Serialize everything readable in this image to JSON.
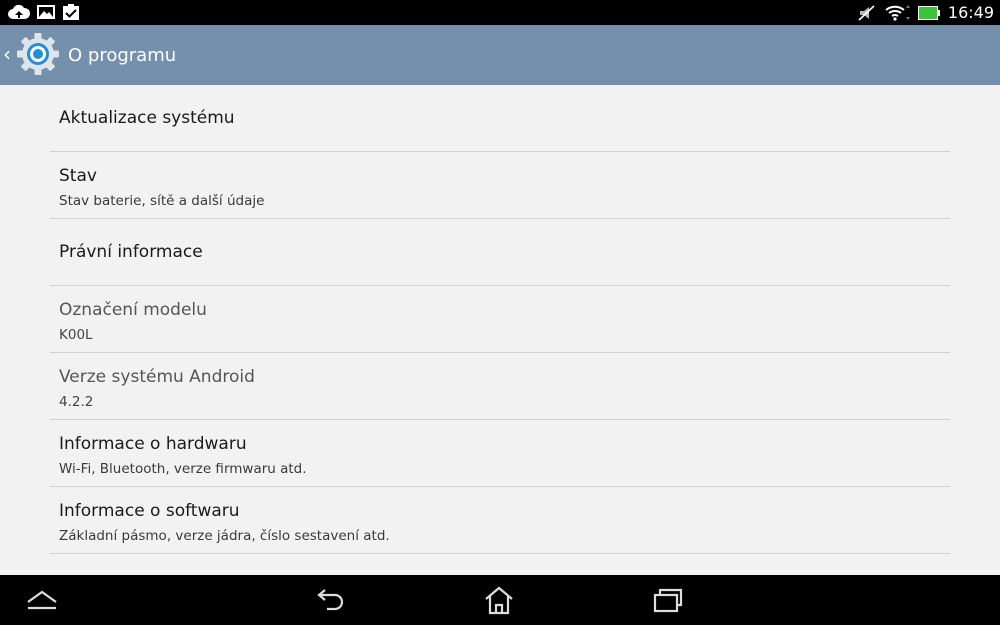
{
  "status_bar": {
    "time": "16:49",
    "left_icons": [
      "cloud-upload-icon",
      "image-icon",
      "clipboard-check-icon"
    ],
    "right_icons": [
      "mute-icon",
      "wifi-icon",
      "battery-icon"
    ]
  },
  "action_bar": {
    "title": "O programu",
    "back_glyph": "‹",
    "accent_color": "#7490ac"
  },
  "items": [
    {
      "title": "Aktualizace systému",
      "subtitle": "",
      "enabled": true
    },
    {
      "title": "Stav",
      "subtitle": "Stav baterie, sítě a další údaje",
      "enabled": true
    },
    {
      "title": "Právní informace",
      "subtitle": "",
      "enabled": true
    },
    {
      "title": "Označení modelu",
      "subtitle": "K00L",
      "enabled": false
    },
    {
      "title": "Verze systému Android",
      "subtitle": "4.2.2",
      "enabled": false
    },
    {
      "title": "Informace o hardwaru",
      "subtitle": "Wi-Fi, Bluetooth, verze firmwaru atd.",
      "enabled": true
    },
    {
      "title": "Informace o softwaru",
      "subtitle": "Základní pásmo, verze jádra, číslo sestavení atd.",
      "enabled": true
    }
  ],
  "nav_bar": {
    "buttons": [
      "menu-up-icon",
      "back-icon",
      "home-icon",
      "recent-apps-icon"
    ]
  }
}
